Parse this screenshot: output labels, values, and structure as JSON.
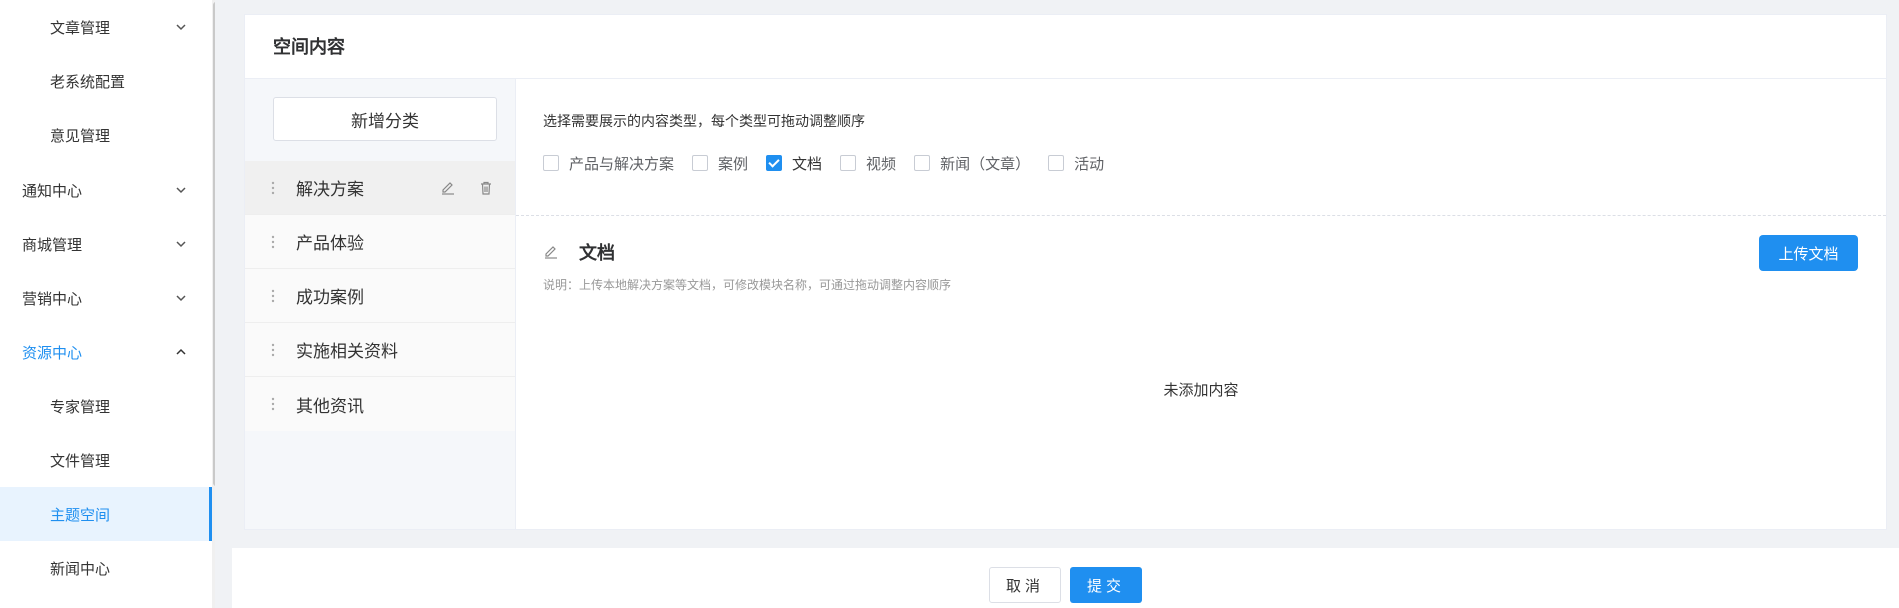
{
  "sidebar": {
    "items": [
      {
        "label": "文章管理",
        "level": 2,
        "chevron": "down"
      },
      {
        "label": "老系统配置",
        "level": 2
      },
      {
        "label": "意见管理",
        "level": 2
      },
      {
        "label": "通知中心",
        "level": 1,
        "chevron": "down"
      },
      {
        "label": "商城管理",
        "level": 1,
        "chevron": "down"
      },
      {
        "label": "营销中心",
        "level": 1,
        "chevron": "down"
      },
      {
        "label": "资源中心",
        "level": 1,
        "chevron": "up",
        "active": true
      },
      {
        "label": "专家管理",
        "level": 2
      },
      {
        "label": "文件管理",
        "level": 2
      },
      {
        "label": "主题空间",
        "level": 2,
        "selected": true
      },
      {
        "label": "新闻中心",
        "level": 2
      }
    ]
  },
  "panel": {
    "title": "空间内容",
    "add_category_label": "新增分类",
    "categories": [
      {
        "label": "解决方案",
        "selected": true
      },
      {
        "label": "产品体验"
      },
      {
        "label": "成功案例"
      },
      {
        "label": "实施相关资料"
      },
      {
        "label": "其他资讯"
      }
    ],
    "hint": "选择需要展示的内容类型，每个类型可拖动调整顺序",
    "content_types": [
      {
        "label": "产品与解决方案",
        "checked": false
      },
      {
        "label": "案例",
        "checked": false
      },
      {
        "label": "文档",
        "checked": true
      },
      {
        "label": "视频",
        "checked": false
      },
      {
        "label": "新闻（文章）",
        "checked": false
      },
      {
        "label": "活动",
        "checked": false
      }
    ],
    "section_title": "文档",
    "upload_label": "上传文档",
    "description": "说明：上传本地解决方案等文档，可修改模块名称，可通过拖动调整内容顺序",
    "empty_text": "未添加内容"
  },
  "footer": {
    "cancel_label": "取消",
    "submit_label": "提交"
  },
  "colors": {
    "accent": "#1f8ff0",
    "selected_bg": "#e8f3fe"
  }
}
